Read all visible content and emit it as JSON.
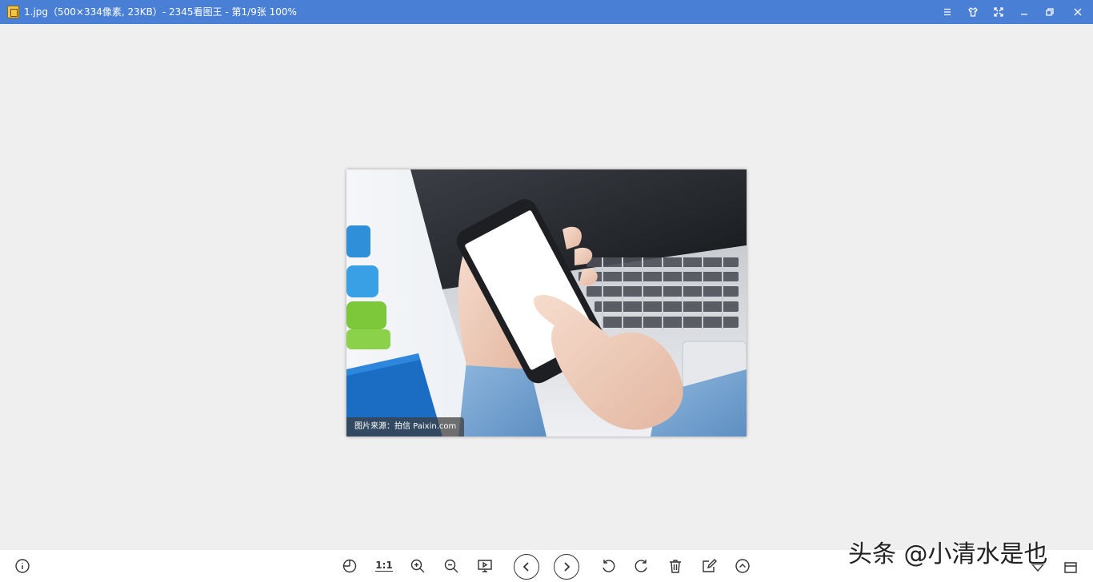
{
  "titlebar": {
    "title": "1.jpg（500×334像素, 23KB）- 2345看图王 - 第1/9张 100%",
    "buttons": [
      "menu-icon",
      "skin-icon",
      "fullscreen-icon",
      "minimize-icon",
      "restore-icon",
      "close-icon"
    ],
    "bg_color": "#4a7fd6"
  },
  "photo": {
    "watermark": "图片来源：拍信 Paixin.com"
  },
  "toolbar": {
    "ratio_label": "1:1",
    "tools": [
      "info-icon",
      "mouse-icon",
      "actual-size",
      "zoom-in-icon",
      "zoom-out-icon",
      "slideshow-icon",
      "prev-icon",
      "next-icon",
      "rotate-left-icon",
      "rotate-right-icon",
      "delete-icon",
      "edit-icon",
      "expand-up-icon"
    ]
  },
  "overlay": {
    "brand_text": "头条 @小清水是也"
  }
}
